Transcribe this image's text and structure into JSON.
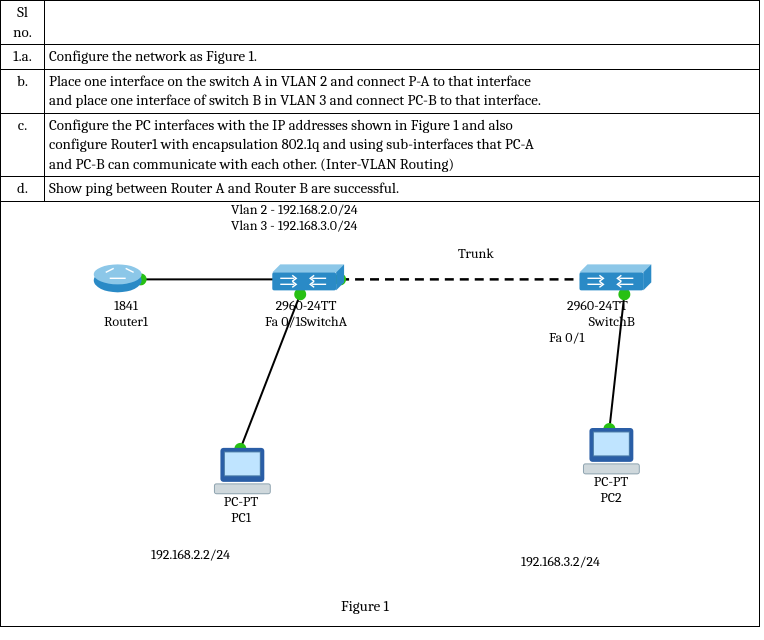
{
  "header": {
    "sl_line1": "Sl",
    "sl_line2": "no.",
    "body": ""
  },
  "rows": {
    "a": {
      "sl": "1.a.",
      "text": "Configure the network as Figure 1."
    },
    "b": {
      "sl": "b.",
      "text": "Place one interface on the switch A in VLAN 2 and connect P-A to that interface\nand place one interface of switch B in VLAN 3 and connect PC-B to that interface."
    },
    "c": {
      "sl": "c.",
      "text": "Configure the PC interfaces with the IP addresses shown in Figure 1 and also\nconfigure Router1 with encapsulation 802.1q and using sub-interfaces that PC-A\nand PC-B can communicate with each other. (Inter-VLAN Routing)"
    },
    "d": {
      "sl": "d.",
      "text": "Show ping between Router A and Router B are successful."
    }
  },
  "diagram": {
    "caption": "Figure 1",
    "labels": {
      "vlan2": "Vlan 2 - 192.168.2.0/24",
      "vlan3": "Vlan 3 - 192.168.3.0/24",
      "trunk": "Trunk",
      "router_model": "1841",
      "router_name": "Router1",
      "switchA_model": "2960-24TT",
      "switchA_port": "Fa 0/1",
      "switchA_name": "SwitchA",
      "switchB_model": "2960-24TT",
      "switchB_name": "SwitchB",
      "switchB_port": "Fa 0/1",
      "pc1_type": "PC-PT",
      "pc1_name": "PC1",
      "pc1_ip": "192.168.2.2/24",
      "pc2_type": "PC-PT",
      "pc2_name": "PC2",
      "pc2_ip": "192.168.3.2/24"
    }
  },
  "chart_data": {
    "type": "network-diagram",
    "vlans": [
      {
        "id": 2,
        "subnet": "192.168.2.0/24"
      },
      {
        "id": 3,
        "subnet": "192.168.3.0/24"
      }
    ],
    "nodes": [
      {
        "id": "Router1",
        "kind": "router",
        "model": "1841"
      },
      {
        "id": "SwitchA",
        "kind": "switch",
        "model": "2960-24TT"
      },
      {
        "id": "SwitchB",
        "kind": "switch",
        "model": "2960-24TT"
      },
      {
        "id": "PC1",
        "kind": "pc",
        "model": "PC-PT",
        "ip": "192.168.2.2/24",
        "vlan": 2
      },
      {
        "id": "PC2",
        "kind": "pc",
        "model": "PC-PT",
        "ip": "192.168.3.2/24",
        "vlan": 3
      }
    ],
    "links": [
      {
        "endpoints": [
          "Router1",
          "SwitchA"
        ],
        "type": "solid"
      },
      {
        "endpoints": [
          "SwitchA",
          "SwitchB"
        ],
        "type": "trunk",
        "label": "Trunk",
        "style": "dashed"
      },
      {
        "endpoints": [
          "SwitchA",
          "PC1"
        ],
        "type": "solid",
        "portA": "Fa 0/1"
      },
      {
        "endpoints": [
          "SwitchB",
          "PC2"
        ],
        "type": "solid",
        "portB": "Fa 0/1"
      }
    ],
    "figure_label": "Figure 1"
  }
}
